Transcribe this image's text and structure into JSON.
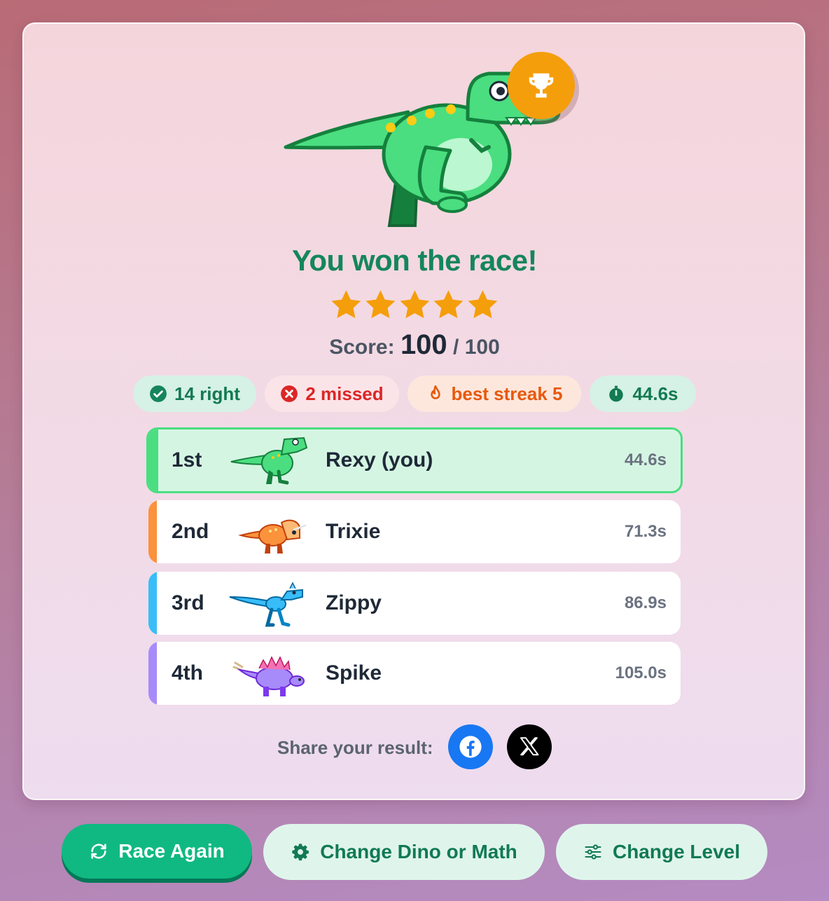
{
  "result": {
    "title": "You won the race!",
    "stars": 5,
    "score_label": "Score:",
    "score_value": "100",
    "score_max": "/ 100"
  },
  "stats": {
    "right": "14 right",
    "missed": "2 missed",
    "streak": "best streak 5",
    "time": "44.6s"
  },
  "leaderboard": [
    {
      "place": "1st",
      "name": "Rexy (you)",
      "time": "44.6s",
      "color": "#4ade80",
      "dino": "green-trex"
    },
    {
      "place": "2nd",
      "name": "Trixie",
      "time": "71.3s",
      "color": "#fb923c",
      "dino": "orange-triceratops"
    },
    {
      "place": "3rd",
      "name": "Zippy",
      "time": "86.9s",
      "color": "#38bdf8",
      "dino": "blue-raptor"
    },
    {
      "place": "4th",
      "name": "Spike",
      "time": "105.0s",
      "color": "#a78bfa",
      "dino": "purple-stegosaurus"
    }
  ],
  "share": {
    "label": "Share your result:",
    "facebook_icon": "facebook-icon",
    "x_icon": "x-icon"
  },
  "actions": {
    "race_again": "Race Again",
    "change_dino": "Change Dino or Math",
    "change_level": "Change Level"
  },
  "colors": {
    "accent_green": "#10b981",
    "title_green": "#15865c",
    "trophy": "#f59e0b",
    "facebook": "#1877f2"
  }
}
